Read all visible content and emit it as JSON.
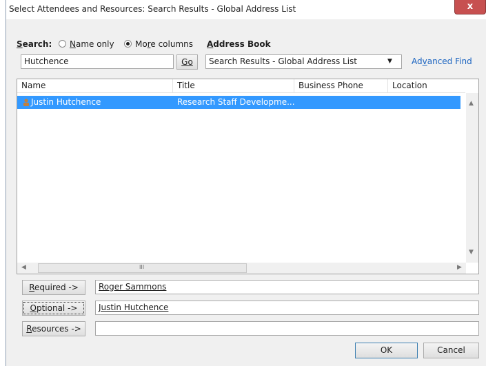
{
  "window": {
    "title": "Select Attendees and Resources: Search Results - Global Address List",
    "close": "x"
  },
  "search": {
    "label": "Search:",
    "name_only": "Name only",
    "more_columns": "More columns",
    "selected": "More columns",
    "value": "Hutchence",
    "go": "Go"
  },
  "address_book": {
    "label": "Address Book",
    "selected": "Search Results - Global Address List",
    "advanced_find": "Advanced Find"
  },
  "columns": [
    "Name",
    "Title",
    "Business Phone",
    "Location"
  ],
  "rows": [
    {
      "name": "Justin Hutchence",
      "title": "Research Staff Developme...",
      "phone": "",
      "location": "",
      "selected": true
    }
  ],
  "scroll": {
    "thumb_glyph": "III"
  },
  "recipients": {
    "required": {
      "button": "Required ->",
      "value": "Roger Sammons"
    },
    "optional": {
      "button": "Optional ->",
      "value": "Justin Hutchence"
    },
    "resources": {
      "button": "Resources ->",
      "value": ""
    }
  },
  "footer": {
    "ok": "OK",
    "cancel": "Cancel"
  },
  "colors": {
    "selection": "#3399ff",
    "link": "#1a63c0",
    "close": "#c75050"
  }
}
